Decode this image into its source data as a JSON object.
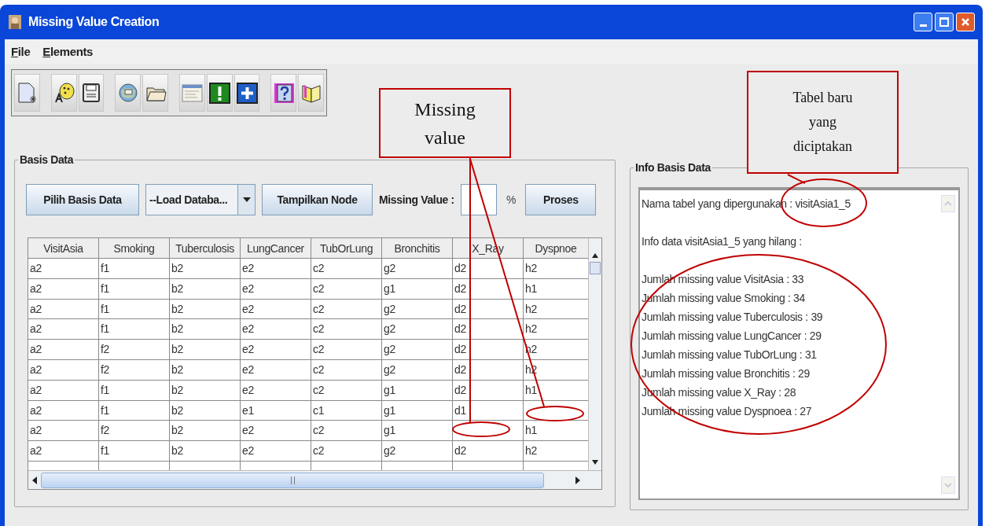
{
  "window": {
    "title": "Missing Value Creation"
  },
  "menu": [
    {
      "label": "File"
    },
    {
      "label": "Elements"
    }
  ],
  "basis_data": {
    "title": "Basis Data",
    "choose_button": "Pilih Basis Data",
    "database_select": "--Load Databa...",
    "show_button": "Tampilkan Node",
    "missing_value_label": "Missing Value :",
    "percent_label": "%",
    "process_button": "Proses",
    "table": {
      "columns": [
        "VisitAsia",
        "Smoking",
        "Tuberculosis",
        "LungCancer",
        "TubOrLung",
        "Bronchitis",
        "X_Ray",
        "Dyspnoe"
      ],
      "rows": [
        [
          "a2",
          "f1",
          "b2",
          "e2",
          "c2",
          "g2",
          "d2",
          "h2"
        ],
        [
          "a2",
          "f1",
          "b2",
          "e2",
          "c2",
          "g1",
          "d2",
          "h1"
        ],
        [
          "a2",
          "f1",
          "b2",
          "e2",
          "c2",
          "g2",
          "d2",
          "h2"
        ],
        [
          "a2",
          "f1",
          "b2",
          "e2",
          "c2",
          "g2",
          "d2",
          "h2"
        ],
        [
          "a2",
          "f2",
          "b2",
          "e2",
          "c2",
          "g2",
          "d2",
          "h2"
        ],
        [
          "a2",
          "f2",
          "b2",
          "e2",
          "c2",
          "g2",
          "d2",
          "h2"
        ],
        [
          "a2",
          "f1",
          "b2",
          "e2",
          "c2",
          "g1",
          "d2",
          "h1"
        ],
        [
          "a2",
          "f1",
          "b2",
          "e1",
          "c1",
          "g1",
          "d1",
          null
        ],
        [
          "a2",
          "f2",
          "b2",
          "e2",
          "c2",
          "g1",
          null,
          "h1"
        ],
        [
          "a2",
          "f1",
          "b2",
          "e2",
          "c2",
          "g2",
          "d2",
          "h2"
        ]
      ]
    }
  },
  "info": {
    "title": "Info Basis Data",
    "paragraphs": [
      [
        "Nama tabel yang dipergunakan : visitAsia1_5"
      ],
      [
        "Info data visitAsia1_5 yang hilang :"
      ],
      [
        "Jumlah missing value VisitAsia : 33",
        "Jumlah missing value Smoking : 34",
        "Jumlah missing value Tuberculosis : 39",
        "Jumlah missing value LungCancer : 29",
        "Jumlah missing value TubOrLung : 31",
        "Jumlah missing value Bronchitis : 29",
        "Jumlah missing value X_Ray : 28",
        "Jumlah missing value Dyspnoea : 27"
      ]
    ]
  },
  "annotations": [
    {
      "kind": "callout",
      "lines": [
        "Missing",
        "value"
      ]
    },
    {
      "kind": "callout",
      "lines": [
        "Tabel baru",
        "yang",
        "diciptakan"
      ]
    }
  ]
}
